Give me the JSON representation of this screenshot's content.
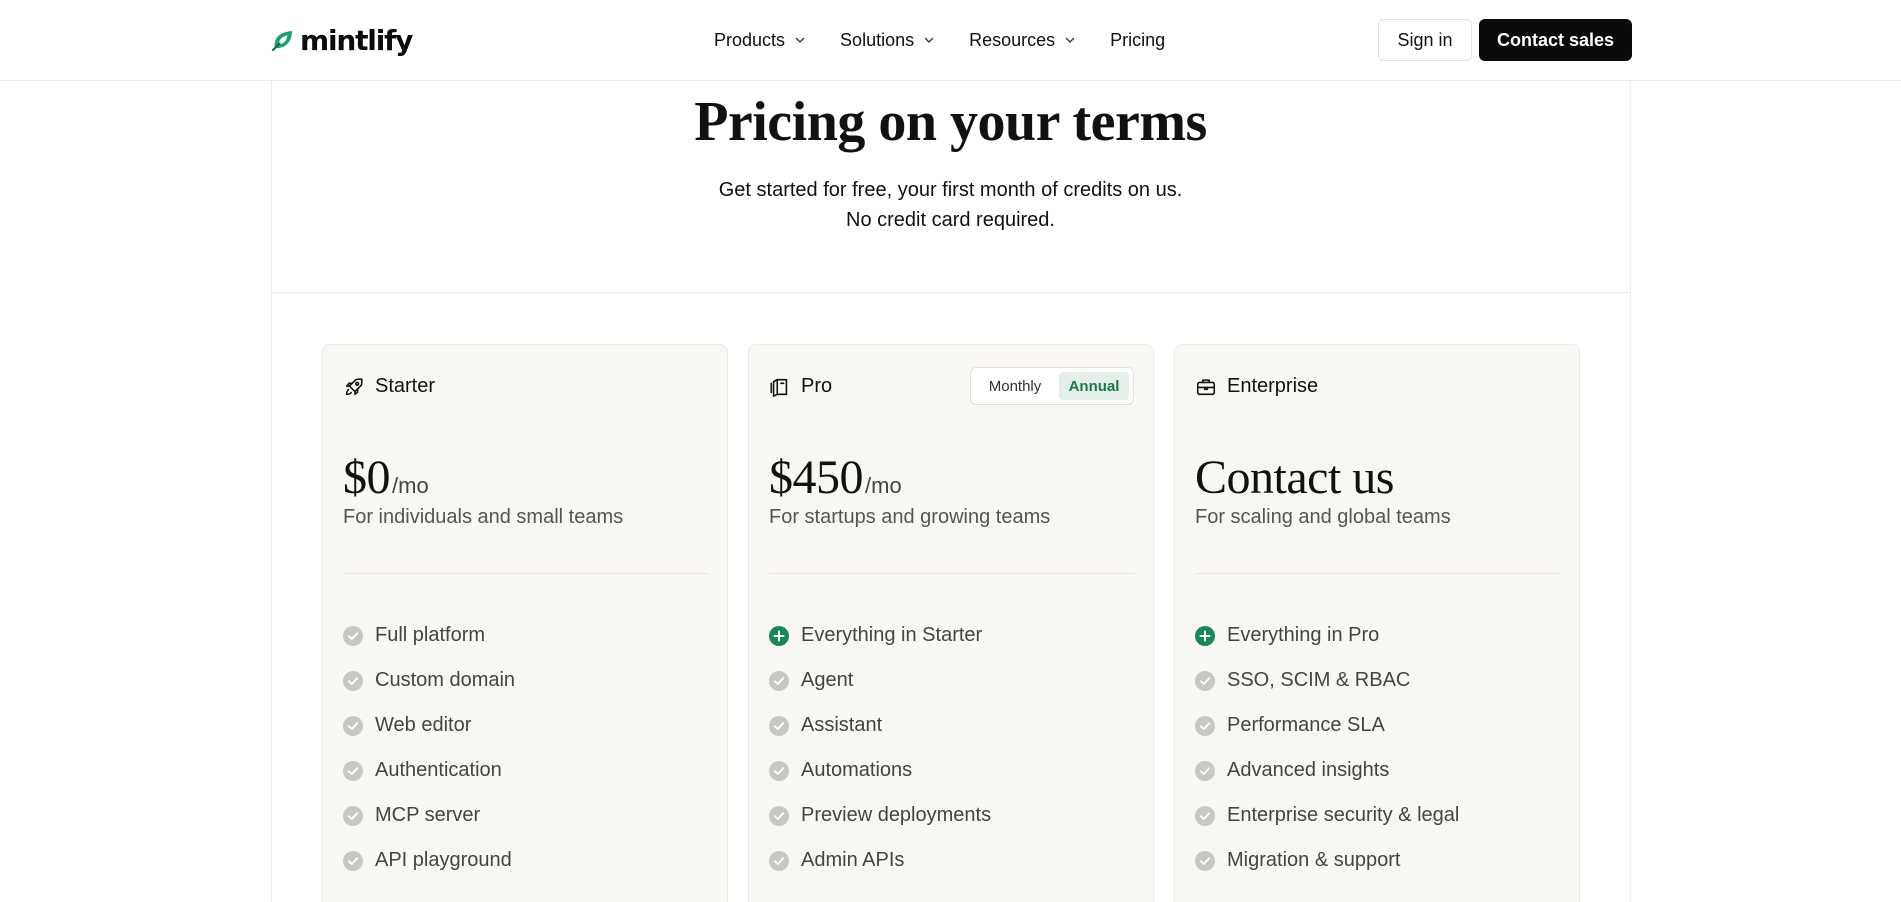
{
  "brand": {
    "name": "mintlify",
    "accent": "#18a36a"
  },
  "nav": {
    "items": [
      {
        "label": "Products",
        "dropdown": true
      },
      {
        "label": "Solutions",
        "dropdown": true
      },
      {
        "label": "Resources",
        "dropdown": true
      },
      {
        "label": "Pricing",
        "dropdown": false
      }
    ],
    "sign_in": "Sign in",
    "contact_sales": "Contact sales"
  },
  "hero": {
    "title": "Pricing on your terms",
    "subtitle_line1": "Get started for free, your first month of credits on us.",
    "subtitle_line2": "No credit card required."
  },
  "plans": [
    {
      "name": "Starter",
      "icon": "rocket-icon",
      "price": "$0",
      "unit": "/mo",
      "description": "For individuals and small teams",
      "features": [
        {
          "text": "Full platform",
          "icon": "check-icon"
        },
        {
          "text": "Custom domain",
          "icon": "check-icon"
        },
        {
          "text": "Web editor",
          "icon": "check-icon"
        },
        {
          "text": "Authentication",
          "icon": "check-icon"
        },
        {
          "text": "MCP server",
          "icon": "check-icon"
        },
        {
          "text": "API playground",
          "icon": "check-icon"
        }
      ]
    },
    {
      "name": "Pro",
      "icon": "book-icon",
      "price": "$450",
      "unit": "/mo",
      "description": "For startups and growing teams",
      "billing_toggle": {
        "monthly": "Monthly",
        "annual": "Annual",
        "selected": "Annual"
      },
      "features": [
        {
          "text": "Everything in Starter",
          "icon": "plus-icon"
        },
        {
          "text": "Agent",
          "icon": "check-icon"
        },
        {
          "text": "Assistant",
          "icon": "check-icon"
        },
        {
          "text": "Automations",
          "icon": "check-icon"
        },
        {
          "text": "Preview deployments",
          "icon": "check-icon"
        },
        {
          "text": "Admin APIs",
          "icon": "check-icon"
        }
      ]
    },
    {
      "name": "Enterprise",
      "icon": "briefcase-icon",
      "price": "Contact us",
      "unit": "",
      "description": "For scaling and global teams",
      "features": [
        {
          "text": "Everything in Pro",
          "icon": "plus-icon"
        },
        {
          "text": "SSO, SCIM & RBAC",
          "icon": "check-icon"
        },
        {
          "text": "Performance SLA",
          "icon": "check-icon"
        },
        {
          "text": "Advanced insights",
          "icon": "check-icon"
        },
        {
          "text": "Enterprise security & legal",
          "icon": "check-icon"
        },
        {
          "text": "Migration & support",
          "icon": "check-icon"
        }
      ]
    }
  ],
  "colors": {
    "check": "#c9c7c2",
    "plus": "#158a57",
    "card_bg": "#f8f7f3",
    "toggle_active": "#e4efe9"
  }
}
